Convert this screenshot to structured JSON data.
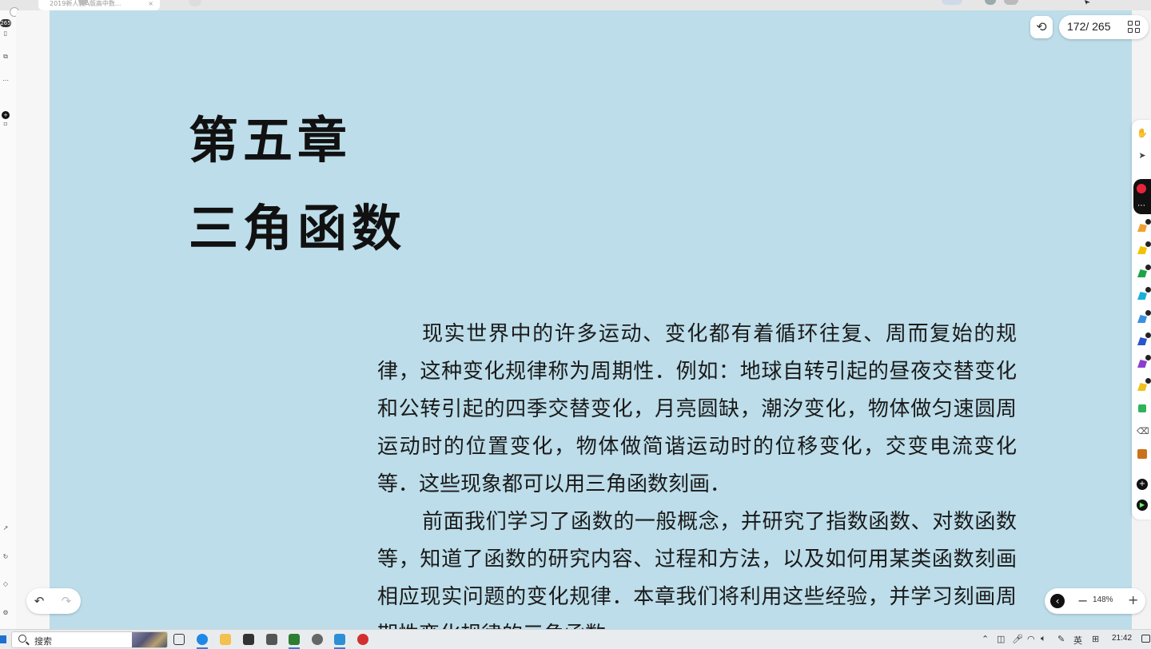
{
  "browser": {
    "tab_title": "2019新人教A版高中数...",
    "tab_close": "×"
  },
  "left_rail": {
    "page_count_badge": "265"
  },
  "viewer": {
    "page_indicator": "172/ 265",
    "zoom_level": "148%",
    "zoom_out_label": "−",
    "zoom_in_label": "+"
  },
  "book": {
    "chapter_number": "第五章",
    "chapter_title": "三角函数",
    "paragraphs": [
      "现实世界中的许多运动、变化都有着循环往复、周而复始的规律，这种变化规律称为周期性．例如：地球自转引起的昼夜交替变化和公转引起的四季交替变化，月亮圆缺，潮汐变化，物体做匀速圆周运动时的位置变化，物体做简谐运动时的位移变化，交变电流变化等．这些现象都可以用三角函数刻画．",
      "前面我们学习了函数的一般概念，并研究了指数函数、对数函数等，知道了函数的研究内容、过程和方法，以及如何用某类函数刻画相应现实问题的变化规律．本章我们将利用这些经验，并学习刻画周期性变化规律的三角函数．"
    ]
  },
  "taskbar": {
    "search_placeholder": "搜索",
    "ime_label": "英",
    "clock": "21:42"
  },
  "colors": {
    "page_background": "#bcdde9",
    "accent": "#3a7bd5"
  }
}
